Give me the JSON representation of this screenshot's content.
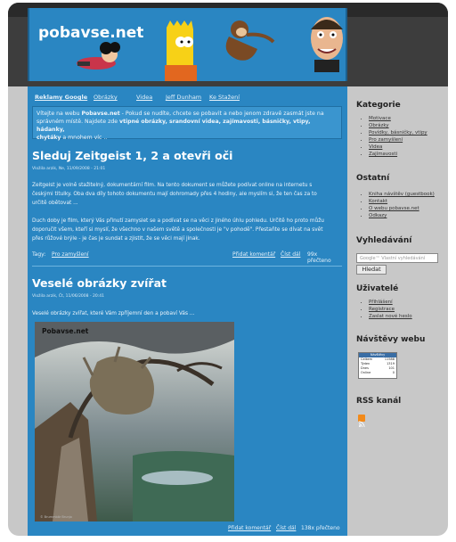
{
  "header": {
    "logo": "pobavse.net"
  },
  "nav": [
    "Reklamy Google",
    "Obrázky",
    "Videa",
    "Jeff Dunham",
    "Ke Stažení"
  ],
  "welcome": {
    "line1": "Vítejte na webu ",
    "site": "Pobavse.net",
    "line1b": " - Pokud se nudíte, chcete se pobavit a nebo jenom zdravě zasmát jste na",
    "line2": "správném místě. Najdete zde ",
    "highlights": "vtipné obrázky, srandovní videa, zajímavosti, básničky, vtipy, hádanky,",
    "line3a": "chytáky",
    "line3b": " a mnohem víc .."
  },
  "posts": [
    {
      "title": "Sleduj Zeitgeist 1, 2 a otevři oči",
      "meta": "Vložila arzik, Ne, 11/09/2008 - 21:01",
      "para1": [
        "Zeitgeist je volně stažitelný, dokumentární film. Na tento dokument se můžete podívat online na internetu s",
        "českými titulky. Oba dva díly tohoto dokumentu mají dohromady přes 4 hodiny, ale myslím si, že ten čas za to",
        "určitě obětovat ..."
      ],
      "para2": [
        "Duch doby je film, který Vás přinutí zamyslet se a podívat se na věci z jiného úhlu pohledu. Určitě ho proto můžu",
        "doporučit všem, kteří si myslí, že všechno v našem světě a společnosti je \"v pohodě\". Přestaňte se dívat na svět",
        "přes růžové brýle - je čas je sundat a zjistit, že se věci mají jinak."
      ],
      "tags_label": "Tagy:",
      "tag": "Pro zamyšlení",
      "comment": "Přidat komentář",
      "more": "Číst dál",
      "reads": "99x přečteno"
    },
    {
      "title": "Veselé obrázky zvířat",
      "meta": "Vložila arzik, Čt, 11/06/2008 - 20:41",
      "para1": [
        "Veselé obrázky zvířat, které Vám zpříjemní den a pobaví Vás ..."
      ],
      "photo_label": "Pobavse.net",
      "photo_credit": "© Brummbär Brunjo",
      "comment": "Přidat komentář",
      "more": "Číst dál",
      "reads": "138x přečteno"
    }
  ],
  "sidebar": {
    "kategorie_title": "Kategorie",
    "kategorie": [
      "Motivace",
      "Obrázky",
      "Povídky, básničky, vtipy",
      "Pro zamyšlení",
      "Videa",
      "Zajímavosti"
    ],
    "ostatni_title": "Ostatní",
    "ostatni": [
      "Kniha návštěv (guestbook)",
      "Kontakt",
      "O webu pobavse.net",
      "Odkazy"
    ],
    "search_title": "Vyhledávání",
    "search_placeholder": "Google™ Vlastní vyhledávání",
    "search_button": "Hledat",
    "user_title": "Uživatelé",
    "user": [
      "Přihlášení",
      "Registrace",
      "Zaslat nové heslo"
    ],
    "visits_title": "Návštěvy webu",
    "counter_title": "Návštěvy",
    "counter_rows": [
      {
        "label": "Celkem",
        "value": "11588"
      },
      {
        "label": "Týden",
        "value": "1319"
      },
      {
        "label": "Dnes",
        "value": "101"
      },
      {
        "label": "Online",
        "value": "0"
      }
    ],
    "rss_title": "RSS kanál"
  },
  "colors": {
    "main": "#2a86c2",
    "frame": "#c8c8c8",
    "rss": "#f28a1a"
  }
}
